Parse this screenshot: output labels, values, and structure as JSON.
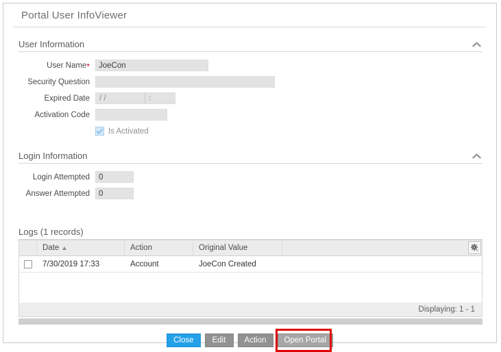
{
  "window": {
    "title": "Portal User InfoViewer"
  },
  "sections": {
    "user_information": {
      "title": "User Information",
      "collapse_icon": "chevron-up-icon",
      "fields": {
        "user_name": {
          "label": "User Name",
          "required_marker": "*",
          "value": "JoeCon"
        },
        "security_question": {
          "label": "Security Question",
          "value": ""
        },
        "expired_date": {
          "label": "Expired Date",
          "date_value": "/ /",
          "time_value": ":"
        },
        "activation_code": {
          "label": "Activation Code",
          "value": ""
        },
        "is_activated": {
          "label": "Is Activated",
          "checked": true,
          "check_icon": "checkmark-icon"
        }
      }
    },
    "login_information": {
      "title": "Login Information",
      "collapse_icon": "chevron-up-icon",
      "fields": {
        "login_attempted": {
          "label": "Login Attempted",
          "value": "0"
        },
        "answer_attempted": {
          "label": "Answer Attempted",
          "value": "0"
        }
      }
    },
    "logs": {
      "title": "Logs (1 records)",
      "settings_icon": "gear-icon",
      "columns": [
        {
          "label": "",
          "key": "checkbox"
        },
        {
          "label": "Date",
          "key": "date",
          "sort": "asc"
        },
        {
          "label": "Action",
          "key": "action"
        },
        {
          "label": "Original Value",
          "key": "original_value"
        },
        {
          "label": "",
          "key": "spacer"
        }
      ],
      "rows": [
        {
          "date": "7/30/2019 17:33",
          "action": "Account",
          "original_value": "JoeCon Created",
          "selected": false
        }
      ],
      "footer": {
        "displaying": "Displaying: 1 - 1"
      }
    }
  },
  "buttons": {
    "close": "Close",
    "edit": "Edit",
    "action": "Action",
    "open_portal": "Open Portal"
  },
  "colors": {
    "primary_button": "#23a0e8",
    "muted_button": "#919191",
    "light_button": "#a6a6a6",
    "highlight_box": "#e00000",
    "required_asterisk": "#d0021b",
    "field_background": "#e3e3e3"
  }
}
